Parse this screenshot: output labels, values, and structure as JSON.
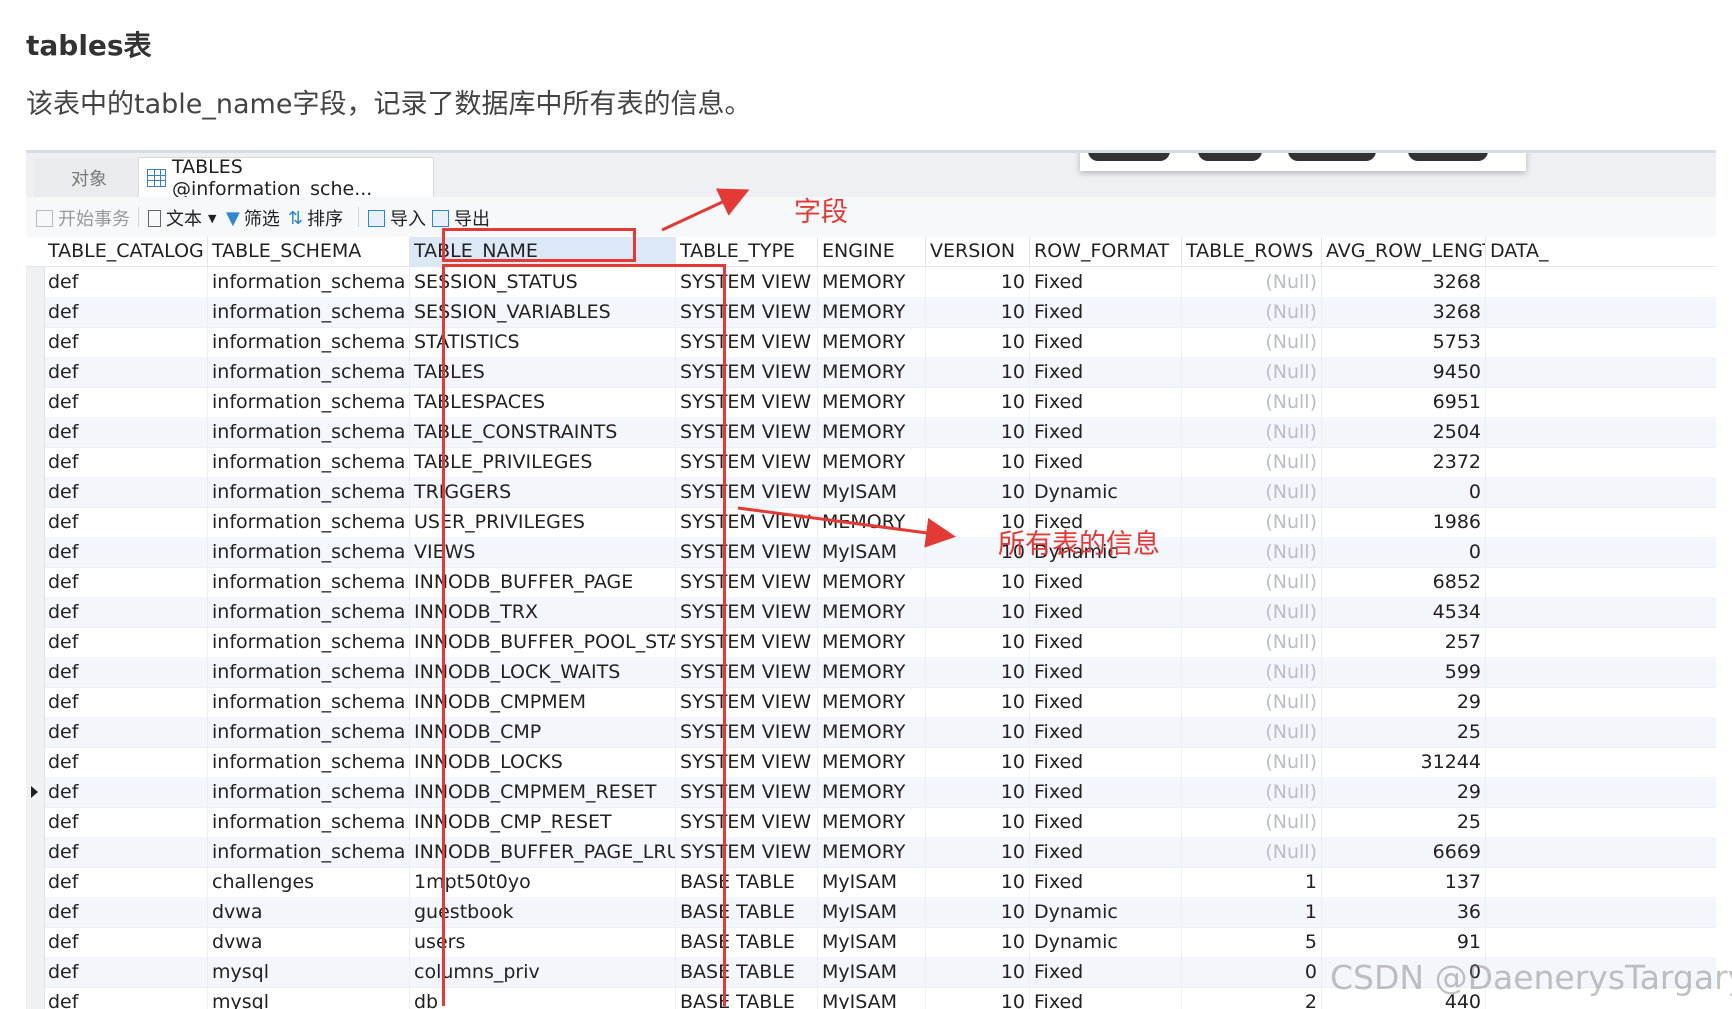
{
  "article": {
    "heading": "tables表",
    "description": "该表中的table_name字段，记录了数据库中所有表的信息。"
  },
  "tabs": {
    "objects": "对象",
    "active": "TABLES @information_sche..."
  },
  "toolbar": {
    "begin_transaction": "开始事务",
    "text": "文本",
    "filter": "筛选",
    "sort": "排序",
    "import": "导入",
    "export": "导出"
  },
  "columns": [
    "TABLE_CATALOG",
    "TABLE_SCHEMA",
    "TABLE_NAME",
    "TABLE_TYPE",
    "ENGINE",
    "VERSION",
    "ROW_FORMAT",
    "TABLE_ROWS",
    "AVG_ROW_LENGTH",
    "DATA_"
  ],
  "rows": [
    {
      "catalog": "def",
      "schema": "information_schema",
      "name": "SESSION_STATUS",
      "type": "SYSTEM VIEW",
      "engine": "MEMORY",
      "version": "10",
      "row_format": "Fixed",
      "table_rows": "(Null)",
      "avg_row_length": "3268"
    },
    {
      "catalog": "def",
      "schema": "information_schema",
      "name": "SESSION_VARIABLES",
      "type": "SYSTEM VIEW",
      "engine": "MEMORY",
      "version": "10",
      "row_format": "Fixed",
      "table_rows": "(Null)",
      "avg_row_length": "3268"
    },
    {
      "catalog": "def",
      "schema": "information_schema",
      "name": "STATISTICS",
      "type": "SYSTEM VIEW",
      "engine": "MEMORY",
      "version": "10",
      "row_format": "Fixed",
      "table_rows": "(Null)",
      "avg_row_length": "5753"
    },
    {
      "catalog": "def",
      "schema": "information_schema",
      "name": "TABLES",
      "type": "SYSTEM VIEW",
      "engine": "MEMORY",
      "version": "10",
      "row_format": "Fixed",
      "table_rows": "(Null)",
      "avg_row_length": "9450"
    },
    {
      "catalog": "def",
      "schema": "information_schema",
      "name": "TABLESPACES",
      "type": "SYSTEM VIEW",
      "engine": "MEMORY",
      "version": "10",
      "row_format": "Fixed",
      "table_rows": "(Null)",
      "avg_row_length": "6951"
    },
    {
      "catalog": "def",
      "schema": "information_schema",
      "name": "TABLE_CONSTRAINTS",
      "type": "SYSTEM VIEW",
      "engine": "MEMORY",
      "version": "10",
      "row_format": "Fixed",
      "table_rows": "(Null)",
      "avg_row_length": "2504"
    },
    {
      "catalog": "def",
      "schema": "information_schema",
      "name": "TABLE_PRIVILEGES",
      "type": "SYSTEM VIEW",
      "engine": "MEMORY",
      "version": "10",
      "row_format": "Fixed",
      "table_rows": "(Null)",
      "avg_row_length": "2372"
    },
    {
      "catalog": "def",
      "schema": "information_schema",
      "name": "TRIGGERS",
      "type": "SYSTEM VIEW",
      "engine": "MyISAM",
      "version": "10",
      "row_format": "Dynamic",
      "table_rows": "(Null)",
      "avg_row_length": "0"
    },
    {
      "catalog": "def",
      "schema": "information_schema",
      "name": "USER_PRIVILEGES",
      "type": "SYSTEM VIEW",
      "engine": "MEMORY",
      "version": "10",
      "row_format": "Fixed",
      "table_rows": "(Null)",
      "avg_row_length": "1986"
    },
    {
      "catalog": "def",
      "schema": "information_schema",
      "name": "VIEWS",
      "type": "SYSTEM VIEW",
      "engine": "MyISAM",
      "version": "10",
      "row_format": "Dynamic",
      "table_rows": "(Null)",
      "avg_row_length": "0"
    },
    {
      "catalog": "def",
      "schema": "information_schema",
      "name": "INNODB_BUFFER_PAGE",
      "type": "SYSTEM VIEW",
      "engine": "MEMORY",
      "version": "10",
      "row_format": "Fixed",
      "table_rows": "(Null)",
      "avg_row_length": "6852"
    },
    {
      "catalog": "def",
      "schema": "information_schema",
      "name": "INNODB_TRX",
      "type": "SYSTEM VIEW",
      "engine": "MEMORY",
      "version": "10",
      "row_format": "Fixed",
      "table_rows": "(Null)",
      "avg_row_length": "4534"
    },
    {
      "catalog": "def",
      "schema": "information_schema",
      "name": "INNODB_BUFFER_POOL_STATS",
      "type": "SYSTEM VIEW",
      "engine": "MEMORY",
      "version": "10",
      "row_format": "Fixed",
      "table_rows": "(Null)",
      "avg_row_length": "257"
    },
    {
      "catalog": "def",
      "schema": "information_schema",
      "name": "INNODB_LOCK_WAITS",
      "type": "SYSTEM VIEW",
      "engine": "MEMORY",
      "version": "10",
      "row_format": "Fixed",
      "table_rows": "(Null)",
      "avg_row_length": "599"
    },
    {
      "catalog": "def",
      "schema": "information_schema",
      "name": "INNODB_CMPMEM",
      "type": "SYSTEM VIEW",
      "engine": "MEMORY",
      "version": "10",
      "row_format": "Fixed",
      "table_rows": "(Null)",
      "avg_row_length": "29"
    },
    {
      "catalog": "def",
      "schema": "information_schema",
      "name": "INNODB_CMP",
      "type": "SYSTEM VIEW",
      "engine": "MEMORY",
      "version": "10",
      "row_format": "Fixed",
      "table_rows": "(Null)",
      "avg_row_length": "25"
    },
    {
      "catalog": "def",
      "schema": "information_schema",
      "name": "INNODB_LOCKS",
      "type": "SYSTEM VIEW",
      "engine": "MEMORY",
      "version": "10",
      "row_format": "Fixed",
      "table_rows": "(Null)",
      "avg_row_length": "31244"
    },
    {
      "catalog": "def",
      "schema": "information_schema",
      "name": "INNODB_CMPMEM_RESET",
      "type": "SYSTEM VIEW",
      "engine": "MEMORY",
      "version": "10",
      "row_format": "Fixed",
      "table_rows": "(Null)",
      "avg_row_length": "29"
    },
    {
      "catalog": "def",
      "schema": "information_schema",
      "name": "INNODB_CMP_RESET",
      "type": "SYSTEM VIEW",
      "engine": "MEMORY",
      "version": "10",
      "row_format": "Fixed",
      "table_rows": "(Null)",
      "avg_row_length": "25"
    },
    {
      "catalog": "def",
      "schema": "information_schema",
      "name": "INNODB_BUFFER_PAGE_LRU",
      "type": "SYSTEM VIEW",
      "engine": "MEMORY",
      "version": "10",
      "row_format": "Fixed",
      "table_rows": "(Null)",
      "avg_row_length": "6669"
    },
    {
      "catalog": "def",
      "schema": "challenges",
      "name": "1mpt50t0yo",
      "type": "BASE TABLE",
      "engine": "MyISAM",
      "version": "10",
      "row_format": "Fixed",
      "table_rows": "1",
      "avg_row_length": "137"
    },
    {
      "catalog": "def",
      "schema": "dvwa",
      "name": "guestbook",
      "type": "BASE TABLE",
      "engine": "MyISAM",
      "version": "10",
      "row_format": "Dynamic",
      "table_rows": "1",
      "avg_row_length": "36"
    },
    {
      "catalog": "def",
      "schema": "dvwa",
      "name": "users",
      "type": "BASE TABLE",
      "engine": "MyISAM",
      "version": "10",
      "row_format": "Dynamic",
      "table_rows": "5",
      "avg_row_length": "91"
    },
    {
      "catalog": "def",
      "schema": "mysql",
      "name": "columns_priv",
      "type": "BASE TABLE",
      "engine": "MyISAM",
      "version": "10",
      "row_format": "Fixed",
      "table_rows": "0",
      "avg_row_length": "0"
    },
    {
      "catalog": "def",
      "schema": "mysql",
      "name": "db",
      "type": "BASE TABLE",
      "engine": "MyISAM",
      "version": "10",
      "row_format": "Fixed",
      "table_rows": "2",
      "avg_row_length": "440"
    }
  ],
  "current_row": 17,
  "annotations": {
    "field_label": "字段",
    "all_tables_label": "所有表的信息"
  },
  "watermark": "CSDN @DaenerysTargaryen",
  "colors": {
    "annotation": "#e53935",
    "selected_header": "#dde8f6",
    "null_text": "#b9bec6"
  }
}
